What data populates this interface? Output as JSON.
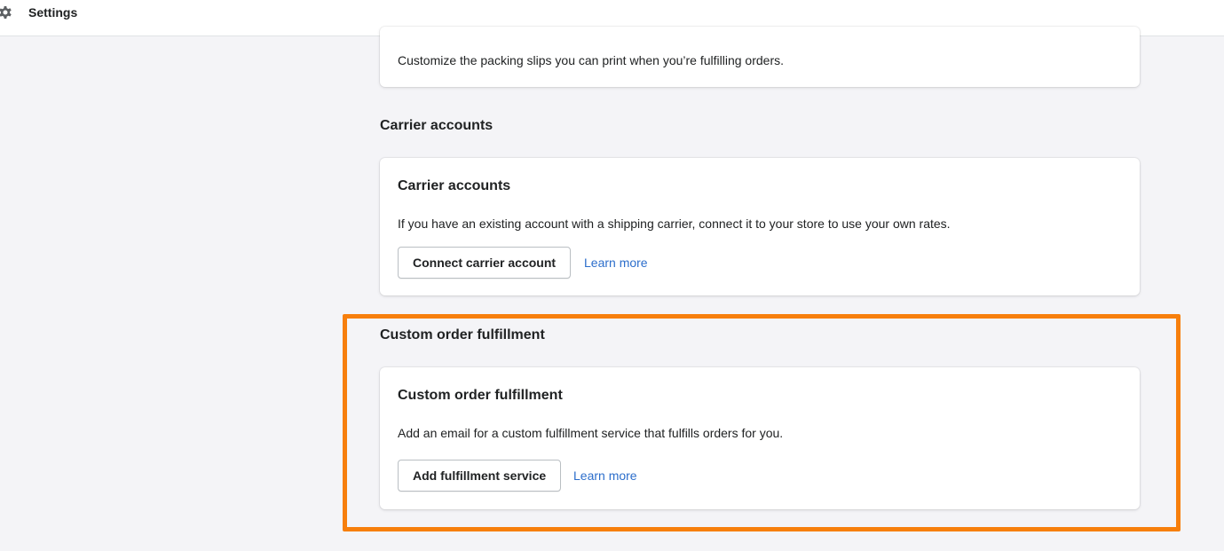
{
  "topbar": {
    "title": "Settings",
    "icon": "gear-icon"
  },
  "packing_slip": {
    "description": "Customize the packing slips you can print when you’re fulfilling orders."
  },
  "carrier_accounts": {
    "section_heading": "Carrier accounts",
    "card_title": "Carrier accounts",
    "description": "If you have an existing account with a shipping carrier, connect it to your store to use your own rates.",
    "button_label": "Connect carrier account",
    "link_label": "Learn more"
  },
  "custom_fulfillment": {
    "section_heading": "Custom order fulfillment",
    "card_title": "Custom order fulfillment",
    "description": "Add an email for a custom fulfillment service that fulfills orders for you.",
    "button_label": "Add fulfillment service",
    "link_label": "Learn more"
  },
  "colors": {
    "background": "#f4f4f7",
    "link": "#2c6ecb",
    "highlight": "#f77f0c"
  }
}
